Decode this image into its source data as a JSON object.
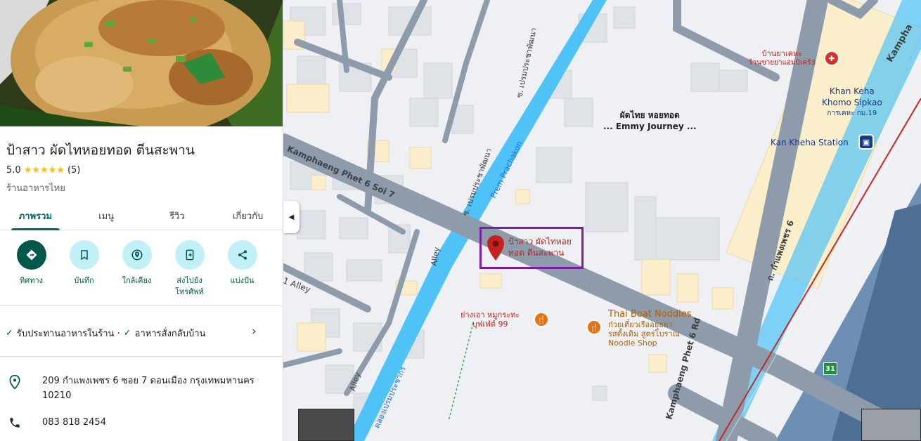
{
  "place": {
    "title": "ป้าสาว ผัดไทหอยทอด ตีนสะพาน",
    "rating": "5.0",
    "stars": "★★★★★",
    "review_count": "(5)",
    "category": "ร้านอาหารไทย"
  },
  "tabs": [
    {
      "label": "ภาพรวม",
      "active": true
    },
    {
      "label": "เมนู",
      "active": false
    },
    {
      "label": "รีวิว",
      "active": false
    },
    {
      "label": "เกี่ยวกับ",
      "active": false
    }
  ],
  "actions": [
    {
      "label": "ทิศทาง",
      "icon": "directions-icon"
    },
    {
      "label": "บันทึก",
      "icon": "bookmark-icon"
    },
    {
      "label": "ใกล้เคียง",
      "icon": "nearby-icon"
    },
    {
      "label": "ส่งไปยัง",
      "label2": "โทรศัพท์",
      "icon": "send-to-phone-icon"
    },
    {
      "label": "แบ่งปัน",
      "icon": "share-icon"
    }
  ],
  "services": {
    "dine_in": "รับประทานอาหารในร้าน ·",
    "takeout": "อาหารสั่งกลับบ้าน"
  },
  "address": {
    "line1": "209 กำแพงเพชร 6 ซอย 7 ดอนเมือง กรุงเทพมหานคร",
    "line2": "10210"
  },
  "phone": "083 818 2454",
  "map": {
    "roads": {
      "kamphaeng_soi7": "Kamphaeng Phet 6 Soi 7",
      "kamphaeng_rd": "Kamphaeng Phet 6 Rd",
      "kamphaeng_thai": "ถ. กำแพงเพชร 6",
      "prem_prachakon": "Prem Prachakon",
      "alley1": "Alley",
      "alley2": "Alley",
      "soi_alley": "1 Alley",
      "thai_road_1": "ซ. เปรมประชาพัฒนา",
      "thai_road_2": "ซ. เปรมประชาพัฒนา",
      "canal": "คลองเปรมประชากร",
      "kamphaeng_corner": "Kampha"
    },
    "pois": {
      "selected_place": {
        "line1": "ป้าสาว ผัดไทหอย",
        "line2": "ทอด ตีนสะพาน"
      },
      "emmy": {
        "line1": "ผัดไทย หอยทอด",
        "line2": "... Emmy Journey ..."
      },
      "ban_ya_kheha": {
        "line1": "บ้านยาเคหะ",
        "line2": "ร้านขายยาแอมบิเคร์3"
      },
      "khan_keha": {
        "line1": "Khan Keha",
        "line2": "Khomo Sipkao",
        "line3": "การเคหะ กม.19"
      },
      "kan_kheha_station": "Kan Kheha Station",
      "yang_ao": {
        "line1": "ย่างเอา หมูกระทะ",
        "line2": "บุฟเฟ่ต์ 99"
      },
      "thai_boat": {
        "line1": "Thai Boat Noddles",
        "line2": "ก๋วยเตี๋ยวเรืออยุธยา",
        "line3": "รสดั้งเดิม สูตรโบราณ",
        "line4": "Noodle Shop"
      },
      "route_shield": "31"
    }
  },
  "colors": {
    "accent": "#00574b",
    "water": "#4fc3f7",
    "road": "#8e9bab",
    "pin": "#c5221f",
    "highlight_box": "#7b1fa2",
    "star": "#fbbc04"
  }
}
